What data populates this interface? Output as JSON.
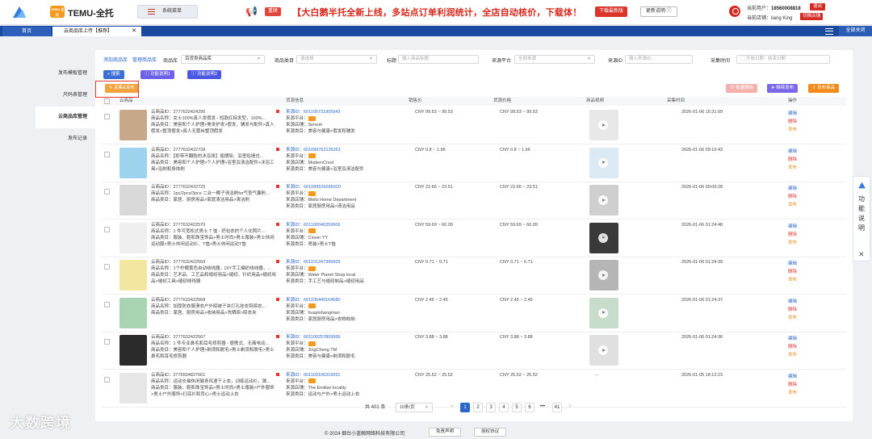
{
  "header": {
    "brand": "TEMU-全托",
    "temu_badge": "TEMU 全托",
    "system_menu": "系统菜单",
    "news_tag": "重磅",
    "news_text": "【大白鹅半托全新上线，多站点订单利润统计，全店自动核价，下载体！",
    "download_button": "下载最新版",
    "update_button": "更新说明 ⓘ",
    "current_user_label": "当前用户：",
    "current_user": "18560008818",
    "logout": "退出",
    "current_shop_label": "当前店铺：",
    "current_shop": "liang King",
    "switch_shop": "切换店铺"
  },
  "tabs": {
    "home": "首页",
    "active": "云商品库上传【推荐】",
    "close_all": "全部关闭"
  },
  "sidebar": {
    "items": [
      "发布模板管理",
      "尺码表管理",
      "云商品库管理",
      "发布记录"
    ]
  },
  "filters": {
    "add_goods": "添加商品库",
    "manage_goods": "管理商品库",
    "goods_lib_label": "商品库",
    "goods_lib_value": "百货类商品库",
    "category_label": "商品类目",
    "category_placeholder": "请选择",
    "title_label": "标题",
    "title_placeholder": "输入商品标题",
    "platform_label": "来源平台",
    "platform_value": "全部来源",
    "source_id_label": "来源ID",
    "source_id_placeholder": "输入来源ID",
    "time_label": "采集时间",
    "start_date": "开始日期",
    "date_sep": "-",
    "end_date": "结束日期"
  },
  "actions": {
    "search": "搜索",
    "fn1": "功能说明1",
    "fn2": "功能说明2",
    "collect": "采集&发布",
    "batch_delete": "批量删除",
    "continue_publish": "继续发布",
    "publish": "发布商品"
  },
  "table": {
    "headers": [
      "云商品",
      "货源信息",
      "销售价",
      "货源价格",
      "商品视频",
      "采集时间",
      "操作"
    ],
    "rows": [
      {
        "cid": "云商品ID：2777632424290",
        "name": "商品名称：女士100%真人发假发 - 短款红棕发型，100%...",
        "cat": "商品类目：美容和个人护理>美发护发>假发，辅发与配件>真人假发>整顶假发>真人无蕾丝整顶假发",
        "sid": "来源ID：601105731905943",
        "pf": "来源平台：",
        "shop": "来源店铺：Serenit",
        "scat": "来源类目：美容与健康>假发和辅发",
        "sale": "CNY 99.53 ~ 99.53",
        "cost": "CNY 99.53 ~ 99.53",
        "video": true,
        "time": "2026-01-06 15:31:09",
        "tc": "#c8a88a",
        "vc": "#e8e8e8"
      },
      {
        "cid": "云商品ID：2777632422728",
        "name": "商品名称：【即带不翻脸的沐浴球】摇摆吸、浴室贴墙也...",
        "cat": "商品类目：美容和个人护理>个人护理>浴室及清洁配件>沐浴工具>浴刷和身体刷",
        "sid": "来源ID：601099763135291",
        "pf": "来源平台：",
        "shop": "来源店铺：ModernCrest",
        "scat": "来源类目：美容与健康>浴室及清洁配件",
        "sale": "CNY 0.8 ~ 1.96",
        "cost": "CNY 0.8 ~ 1.96",
        "video": true,
        "time": "2026-01-06 09:10:43",
        "tc": "#9ed3ee",
        "vc": "#dbe9f2"
      },
      {
        "cid": "云商品ID：2777632422725",
        "name": "商品名称：1pc/2pcs/3pcs 二合一椰子清洁刷for气垫气囊粉...",
        "cat": "商品类目：家居、厨房用品>家庭清洁用品>清洁刷",
        "sid": "来源ID：601099526095920",
        "pf": "来源平台：",
        "shop": "来源店铺：Mello Home Department",
        "scat": "来源类目：家居厨房用品>清洁用品",
        "sale": "CNY 22.66 ~ 23.51",
        "cost": "CNY 22.66 ~ 23.51",
        "video": true,
        "time": "2026-01-06 09:09:28",
        "tc": "#d9d9d9",
        "vc": "#cfcfcf"
      },
      {
        "cid": "云商品ID：2777632422570",
        "name": "商品名称：1 件可宽松式男士 T 恤 - 奶包衣的个人化照片...",
        "cat": "商品类目：服装、鞋和珠宝饰品>男士时尚>男士服装>男士休闲运动服>男士休闲运动衫、T恤>男士休闲运动T恤",
        "sid": "来源ID：601100040259906",
        "pf": "来源平台：",
        "shop": "来源店铺：Clover YY",
        "scat": "来源类目：男装>男士T恤",
        "sale": "CNY 59.69 ~ 60.09",
        "cost": "CNY 59.69 ~ 60.09",
        "video": true,
        "time": "2026-01-06 01:24:48",
        "tc": "#efefef",
        "vc": "#3a3a3a"
      },
      {
        "cid": "云商品ID：2777632422569",
        "name": "商品名称：1个柠檬黄色自动绕线器，DIY手工编织绕线器，...",
        "cat": "商品类目：艺术品、工艺品和缝纫用品>缝纫、针织用品>缝纫用品>缝纫工具>缝纫绕线器",
        "sid": "来源ID：601101247395509",
        "pf": "来源平台：",
        "shop": "来源店铺：Water Planet Shop local",
        "scat": "来源类目：手工艺与缝纫制品>缝纫用品",
        "sale": "CNY 0.71 ~ 0.71",
        "cost": "CNY 0.71 ~ 0.71",
        "video": true,
        "time": "2026-01-06 01:24:39",
        "tc": "#f2e6a0",
        "vc": "#b5b5b5"
      },
      {
        "cid": "云商品ID：2777632422568",
        "name": "商品名称：加厚防衣服滑衣户外晾被子夹打孔挂衣钩晾衣...",
        "cat": "商品类目：家居、厨房用品>收纳用品>洗晒晾>晾衣夹",
        "sid": "来源ID：601105449164580",
        "pf": "来源平台：",
        "shop": "来源店铺：huapishangmao",
        "scat": "来源类目：家居厨房用品>衣物收纳",
        "sale": "CNY 2.45 ~ 2.45",
        "cost": "CNY 2.45 ~ 2.45",
        "video": true,
        "time": "2026-01-06 01:24:37",
        "tc": "#a9d4b4",
        "vc": "#c8dccb"
      },
      {
        "cid": "云商品ID：2777632422567",
        "name": "商品名称：1 件专业鼻毛和耳毛修剪器 - 便携式、无痛电动...",
        "cat": "商品类目：美容和个人护理>剃须和脱毛>男士剃须和脱毛>男士鼻毛和耳毛修剪器",
        "sid": "来源ID：601100257809966",
        "pf": "来源平台：",
        "shop": "来源店铺：JingCheng TM",
        "scat": "来源类目：美容与健康>剃须和脱毛",
        "sale": "CNY 3.88 ~ 3.88",
        "cost": "CNY 3.88 ~ 3.88",
        "video": true,
        "time": "2026-01-06 01:24:36",
        "tc": "#2b2b2b",
        "vc": "#e0e0e0"
      },
      {
        "cid": "云商品ID：2776504827661",
        "name": "商品名称：运动长袖休闲健身风速干上衣，训练运动衫，弹...",
        "cat": "商品类目：服装、鞋和珠宝饰品>男士时尚>男士服装>户外服饰>男士户外服饰>打底衫和背心>男士运动上衣",
        "sid": "来源ID：601103106316651",
        "pf": "来源平台：",
        "shop": "来源店铺：The Emilian locality",
        "scat": "来源类目：运动与户外>男士运动上衣",
        "sale": "CNY 25.52 ~ 25.52",
        "cost": "CNY 25.52 ~ 25.52",
        "video": false,
        "time": "2026-01-05 18:12:23",
        "tc": "#e6e6e6",
        "vc": "#ffffff"
      }
    ],
    "no_video": "--",
    "op_edit": "编辑",
    "op_delete": "删除",
    "op_publish": "发布"
  },
  "pagination": {
    "total": "共 401 条",
    "page_size": "10条/页",
    "pages": [
      "1",
      "2",
      "3",
      "4",
      "5",
      "6",
      "•••",
      "41"
    ],
    "prev": "<",
    "next": ">"
  },
  "footer": {
    "copyright": "© 2024 烟台小蓝鲸网络科技有限公司",
    "disclaimer": "免责声明",
    "license": "授权协议"
  },
  "float_help": {
    "label": "功能说明",
    "close": "✕"
  },
  "watermark": "大数跨境",
  "colors": {
    "brand_blue": "#1a4aa0",
    "accent_red": "#d22c25",
    "link_blue": "#2b67c9",
    "orange": "#f39a1e"
  }
}
